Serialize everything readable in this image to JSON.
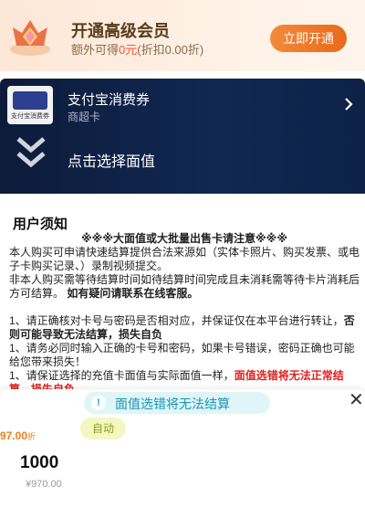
{
  "vip": {
    "title": "开通高级会员",
    "sub_prefix": "额外可得",
    "sub_amount": "0元",
    "sub_suffix": "(折扣0.00折)",
    "button": "立即开通",
    "icon": "diamond-crown-icon"
  },
  "product": {
    "image_caption": "支付宝消费券",
    "title": "支付宝消费券",
    "subtitle": "商超卡",
    "arrow_icon": "chevron-right-icon",
    "select_icon": "double-chevron-down-icon",
    "select_label": "点击选择面值"
  },
  "notice": {
    "title": "用户须知",
    "headline": "※※※大面值或大批量出售卡请注意※※※",
    "p1": "本人购买可申请快速结算提供合法来源如（实体卡照片、购买发票、或电子卡购买记录、）录制视频提交。",
    "p2_pre": "非本人购买需等待结算时间如待结算时间完成且未消耗需等待卡片消耗后方可结算。 ",
    "p2_bold": "如有疑问请联系在线客服。",
    "item1_pre": "1、请正确核对卡号与密码是否相对应，并保证仅在本平台进行转让，",
    "item1_bold": "否则可能导致无法结算，损失自负",
    "item2": "1、请务必同时输入正确的卡号和密码，如果卡号错误，密码正确也可能给您带来损失！",
    "item3_pre": "1、请保证选择的充值卡面值与实际面值一样，",
    "item3_red": "面值选错将无法正常结算，",
    "item3_tail": "损失自负"
  },
  "sheet": {
    "warning_icon": "exclamation-icon",
    "warning": "面值选错将无法结算",
    "close_icon": "close-icon",
    "discount_value": "97.00",
    "discount_unit": "折",
    "auto_badge": "自动",
    "face_value": "1000",
    "price": "¥970.00"
  }
}
